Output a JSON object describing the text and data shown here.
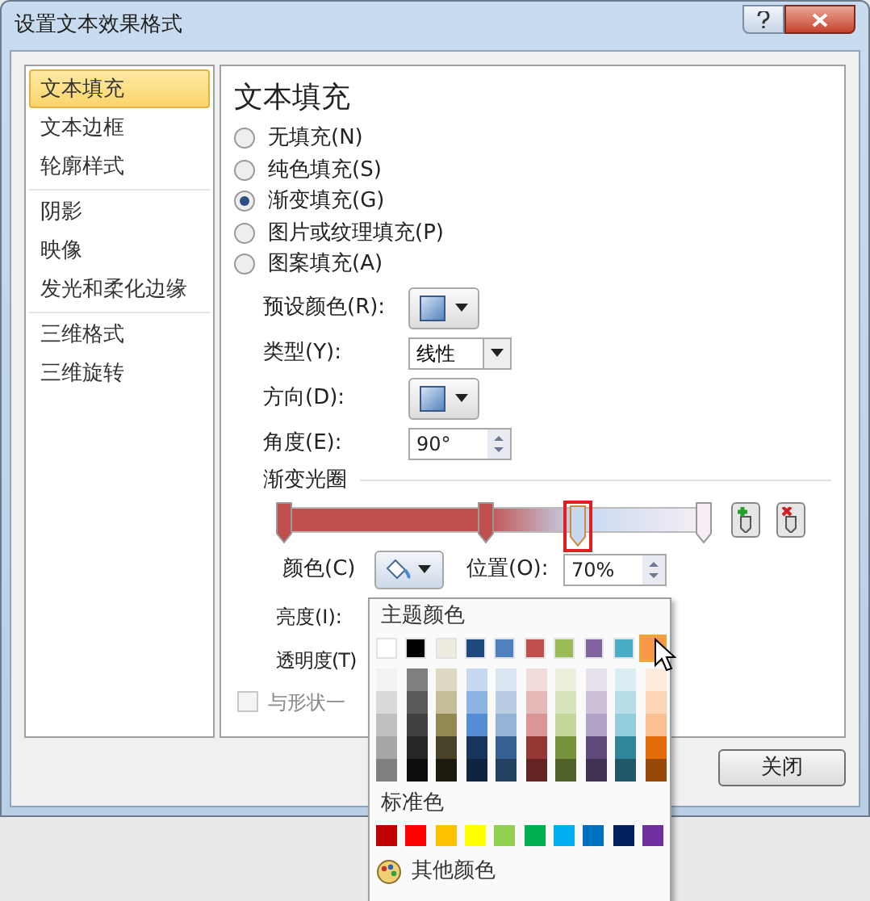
{
  "window": {
    "title": "设置文本效果格式"
  },
  "sidebar": {
    "groups": [
      {
        "items": [
          {
            "label": "文本填充",
            "selected": true
          },
          {
            "label": "文本边框",
            "selected": false
          },
          {
            "label": "轮廓样式",
            "selected": false
          }
        ]
      },
      {
        "items": [
          {
            "label": "阴影",
            "selected": false
          },
          {
            "label": "映像",
            "selected": false
          },
          {
            "label": "发光和柔化边缘",
            "selected": false
          }
        ]
      },
      {
        "items": [
          {
            "label": "三维格式",
            "selected": false
          },
          {
            "label": "三维旋转",
            "selected": false
          }
        ]
      }
    ]
  },
  "panel": {
    "title": "文本填充",
    "fill_options": [
      {
        "label": "无填充(N)",
        "selected": false
      },
      {
        "label": "纯色填充(S)",
        "selected": false
      },
      {
        "label": "渐变填充(G)",
        "selected": true
      },
      {
        "label": "图片或纹理填充(P)",
        "selected": false
      },
      {
        "label": "图案填充(A)",
        "selected": false
      }
    ],
    "fields": [
      {
        "kind": "swatch",
        "label": "预设颜色(R):"
      },
      {
        "kind": "select",
        "label": "类型(Y):",
        "value": "线性"
      },
      {
        "kind": "swatch",
        "label": "方向(D):"
      },
      {
        "kind": "spin",
        "label": "角度(E):",
        "value": "90°"
      }
    ],
    "gradient_stops": {
      "label": "渐变光圈",
      "stops": [
        {
          "level": 0,
          "color": "#c0504d",
          "selected": false
        },
        {
          "level": 0.48,
          "color": "#c0504d",
          "selected": false
        },
        {
          "level": 0.7,
          "color": "#c6d9f1",
          "selected": true
        },
        {
          "level": 1,
          "color": "#f6eef4",
          "selected": false
        }
      ]
    },
    "color_label": "颜色(C)",
    "position_label": "位置(O):",
    "position_value": "70%",
    "brightness_label": "亮度(I):",
    "transparency_label": "透明度(T)",
    "checkbox": {
      "label": "与形状一",
      "checked": false,
      "disabled": true
    }
  },
  "close_button": "关闭",
  "palette": {
    "theme_title": "主题颜色",
    "theme_colors": [
      {
        "color": "#ffffff",
        "selected": false,
        "shades": [
          {
            "color": "#f2f2f2"
          },
          {
            "color": "#d9d9d9"
          },
          {
            "color": "#bfbfbf"
          },
          {
            "color": "#a6a6a6"
          },
          {
            "color": "#808080"
          }
        ]
      },
      {
        "color": "#000000",
        "selected": false,
        "shades": [
          {
            "color": "#7f7f7f"
          },
          {
            "color": "#595959"
          },
          {
            "color": "#404040"
          },
          {
            "color": "#262626"
          },
          {
            "color": "#0d0d0d"
          }
        ]
      },
      {
        "color": "#eeece1",
        "selected": false,
        "shades": [
          {
            "color": "#ddd9c3"
          },
          {
            "color": "#c4bd97"
          },
          {
            "color": "#938953"
          },
          {
            "color": "#494429"
          },
          {
            "color": "#1d1b10"
          }
        ]
      },
      {
        "color": "#1f497d",
        "selected": false,
        "shades": [
          {
            "color": "#c6d9f0"
          },
          {
            "color": "#8db3e2"
          },
          {
            "color": "#548dd4"
          },
          {
            "color": "#17365d"
          },
          {
            "color": "#0f243e"
          }
        ]
      },
      {
        "color": "#4f81bd",
        "selected": false,
        "shades": [
          {
            "color": "#dbe5f1"
          },
          {
            "color": "#b8cce4"
          },
          {
            "color": "#95b3d7"
          },
          {
            "color": "#366092"
          },
          {
            "color": "#244061"
          }
        ]
      },
      {
        "color": "#c0504d",
        "selected": false,
        "shades": [
          {
            "color": "#f2dcdb"
          },
          {
            "color": "#e5b9b7"
          },
          {
            "color": "#d99694"
          },
          {
            "color": "#953734"
          },
          {
            "color": "#632423"
          }
        ]
      },
      {
        "color": "#9bbb59",
        "selected": false,
        "shades": [
          {
            "color": "#ebf1dd"
          },
          {
            "color": "#d7e3bc"
          },
          {
            "color": "#c3d69b"
          },
          {
            "color": "#76923c"
          },
          {
            "color": "#4f6128"
          }
        ]
      },
      {
        "color": "#8064a2",
        "selected": false,
        "shades": [
          {
            "color": "#e5e0ec"
          },
          {
            "color": "#ccc1d9"
          },
          {
            "color": "#b2a2c7"
          },
          {
            "color": "#5f497a"
          },
          {
            "color": "#3f3151"
          }
        ]
      },
      {
        "color": "#4bacc6",
        "selected": false,
        "shades": [
          {
            "color": "#dbeef3"
          },
          {
            "color": "#b7dde8"
          },
          {
            "color": "#92cddc"
          },
          {
            "color": "#31859b"
          },
          {
            "color": "#205867"
          }
        ]
      },
      {
        "color": "#f79646",
        "selected": true,
        "shades": [
          {
            "color": "#fdeada"
          },
          {
            "color": "#fbd5b5"
          },
          {
            "color": "#fac08f"
          },
          {
            "color": "#e36c09"
          },
          {
            "color": "#974806"
          }
        ]
      }
    ],
    "standard_title": "标准色",
    "standard_colors": [
      {
        "color": "#c00000"
      },
      {
        "color": "#ff0000"
      },
      {
        "color": "#ffc000"
      },
      {
        "color": "#ffff00"
      },
      {
        "color": "#92d050"
      },
      {
        "color": "#00b050"
      },
      {
        "color": "#00b0f0"
      },
      {
        "color": "#0070c0"
      },
      {
        "color": "#002060"
      },
      {
        "color": "#7030a0"
      }
    ],
    "more_colors": "其他颜色"
  }
}
